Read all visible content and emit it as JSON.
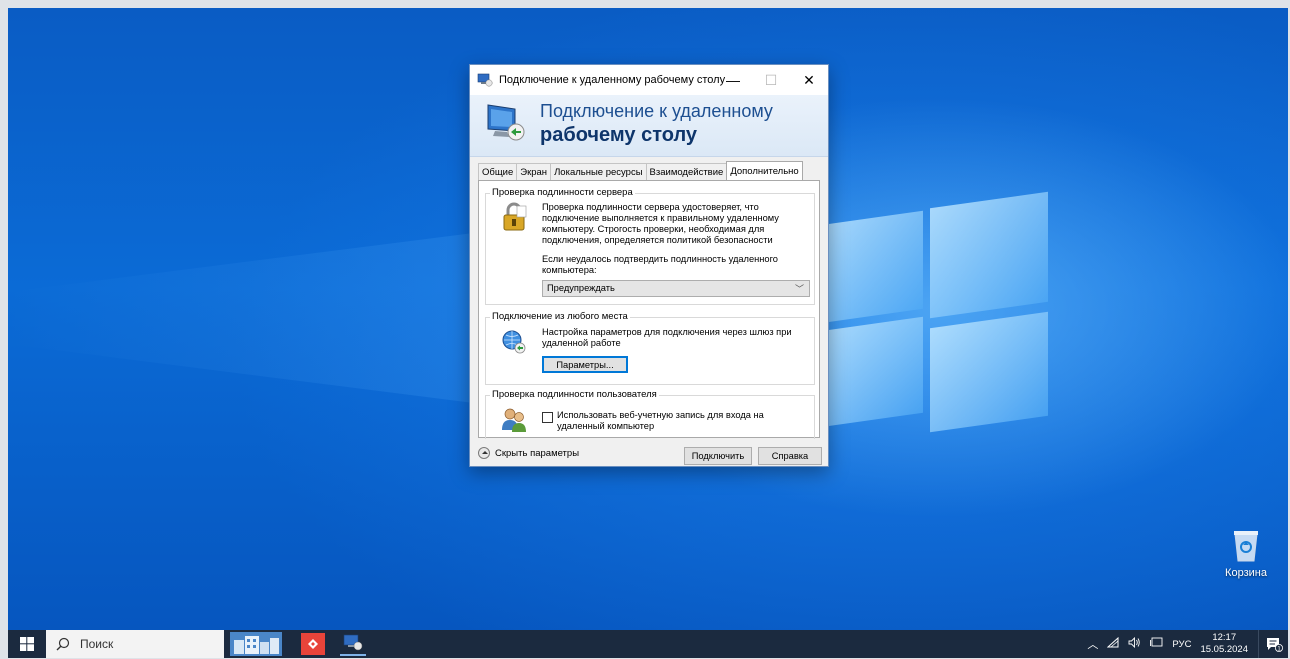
{
  "window": {
    "title": "Подключение к удаленному рабочему столу",
    "min_glyph": "—",
    "max_glyph": "☐",
    "close_glyph": "✕"
  },
  "banner": {
    "line1": "Подключение к удаленному",
    "line2": "рабочему столу"
  },
  "tabs": [
    {
      "label": "Общие"
    },
    {
      "label": "Экран"
    },
    {
      "label": "Локальные ресурсы"
    },
    {
      "label": "Взаимодействие"
    },
    {
      "label": "Дополнительно",
      "active": true
    }
  ],
  "server_auth": {
    "title": "Проверка подлинности сервера",
    "description": "Проверка подлинности сервера удостоверяет, что подключение выполняется к правильному удаленному компьютеру. Строгость проверки, необходимая для подключения, определяется политикой безопасности",
    "if_failed_label": "Если неудалось подтвердить подлинность удаленного компьютера:",
    "selected_option": "Предупреждать",
    "icon": "lock-icon"
  },
  "connect_anywhere": {
    "title": "Подключение из любого места",
    "description": "Настройка параметров для подключения через шлюз при удаленной работе",
    "settings_button": "Параметры...",
    "icon": "network-globe-icon"
  },
  "user_auth": {
    "title": "Проверка подлинности пользователя",
    "checkbox_label": "Использовать веб-учетную запись для входа на удаленный компьютер",
    "checked": false,
    "icon": "users-icon"
  },
  "footer": {
    "hide_options": "Скрыть параметры",
    "connect_button": "Подключить",
    "help_button": "Справка"
  },
  "desktop": {
    "recycle_bin_label": "Корзина"
  },
  "taskbar": {
    "search_placeholder": "Поиск",
    "language": "РУС",
    "time": "12:17",
    "date": "15.05.2024",
    "notification_count": "1"
  },
  "colors": {
    "accent": "#0078d7",
    "taskbar": "#1b2a3f",
    "banner_text": "#1d4f91"
  }
}
